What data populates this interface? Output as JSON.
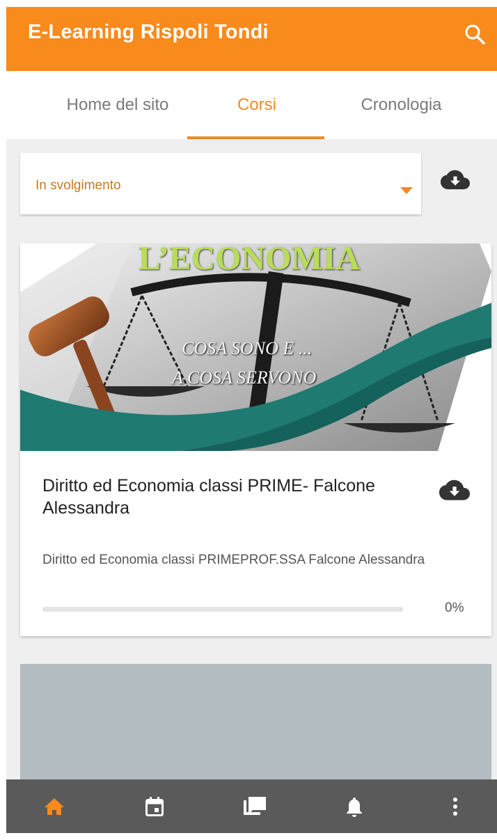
{
  "app": {
    "title": "E-Learning Rispoli Tondi"
  },
  "colors": {
    "accent": "#f98a1c",
    "tab_active": "#f08a22",
    "bottom_nav": "#5a5a5a"
  },
  "icons": {
    "search": "search-icon",
    "download": "cloud-download-icon",
    "nav": [
      "home-icon",
      "calendar-icon",
      "messages-icon",
      "bell-icon",
      "more-vertical-icon"
    ]
  },
  "tabs": [
    {
      "label": "Home del sito",
      "active": false
    },
    {
      "label": "Corsi",
      "active": true
    },
    {
      "label": "Cronologia",
      "active": false
    }
  ],
  "filter": {
    "selected": "In svolgimento"
  },
  "course": {
    "image_text": {
      "heading": "L’ECONOMIA",
      "line1": "COSA SONO E ...",
      "line2": "A COSA SERVONO"
    },
    "title": "Diritto ed Economia classi PRIME- Falcone Alessandra",
    "summary": "Diritto ed Economia  classi PRIMEPROF.SSA Falcone Alessandra",
    "progress": 0,
    "progress_label": "0%"
  }
}
